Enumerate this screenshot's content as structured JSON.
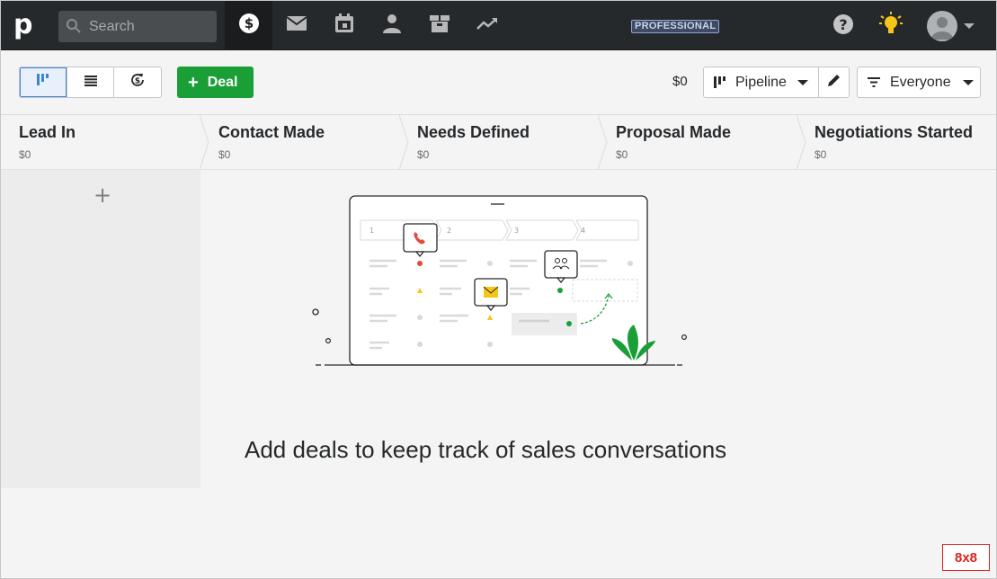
{
  "topbar": {
    "logo": "p",
    "search_placeholder": "Search",
    "plan_badge": "PROFESSIONAL",
    "nav": [
      "deals-icon",
      "mail-icon",
      "calendar-icon",
      "contacts-icon",
      "products-icon",
      "insights-icon"
    ]
  },
  "toolbar": {
    "deal_button": "Deal",
    "deal_plus": "+",
    "total": "$0",
    "pipeline_label": "Pipeline",
    "filter_label": "Everyone",
    "active_view": "kanban"
  },
  "stages": [
    {
      "name": "Lead In",
      "amount": "$0"
    },
    {
      "name": "Contact Made",
      "amount": "$0"
    },
    {
      "name": "Needs Defined",
      "amount": "$0"
    },
    {
      "name": "Proposal Made",
      "amount": "$0"
    },
    {
      "name": "Negotiations Started",
      "amount": "$0"
    }
  ],
  "board": {
    "add_symbol": "+",
    "empty_message": "Add deals to keep track of sales conversations",
    "illustration_steps": [
      "1",
      "2",
      "3",
      "4"
    ]
  },
  "corner_badge": "8x8",
  "colors": {
    "accent_green": "#1a9f37",
    "nav_bg": "#26292c",
    "active_blue": "#3f83d4",
    "badge_red": "#e01e1e"
  }
}
